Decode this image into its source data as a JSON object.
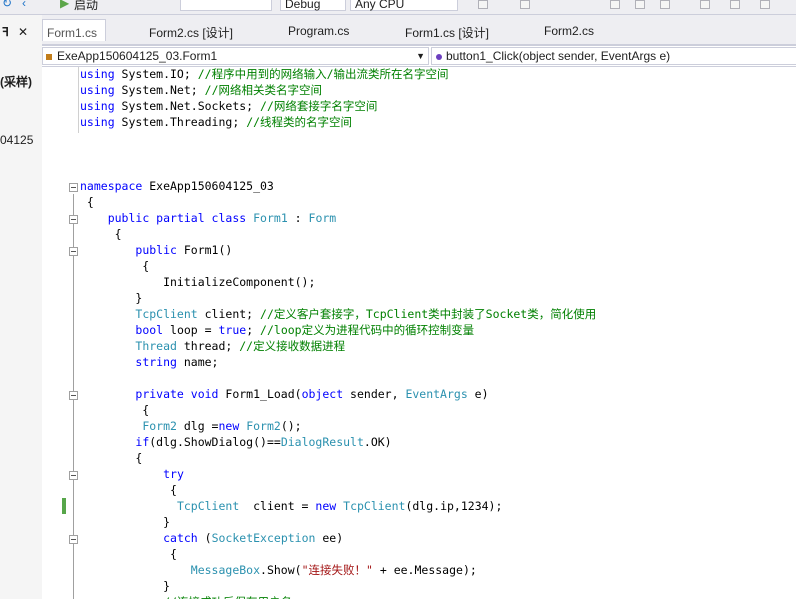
{
  "toolbar": {
    "start_label": "启动",
    "config": "Debug",
    "platform": "Any CPU"
  },
  "left_panel": {
    "pin": "ꟻ",
    "close": "✕",
    "label1": "(采样)",
    "label2": "04125"
  },
  "tabs": [
    {
      "label": "Form1.cs"
    },
    {
      "label": "Form2.cs [设计]"
    },
    {
      "label": "Program.cs"
    },
    {
      "label": "Form1.cs [设计]"
    },
    {
      "label": "Form2.cs"
    }
  ],
  "nav": {
    "class_path": "ExeApp150604125_03.Form1",
    "member": "button1_Click(object sender, EventArgs e)"
  },
  "code": [
    [
      [
        "kw",
        "using"
      ],
      [
        "p",
        " System.IO; "
      ],
      [
        "cm",
        "//程序中用到的网络输入/输出流类所在名字空间"
      ]
    ],
    [
      [
        "kw",
        "using"
      ],
      [
        "p",
        " System.Net; "
      ],
      [
        "cm",
        "//网络相关类名字空间"
      ]
    ],
    [
      [
        "kw",
        "using"
      ],
      [
        "p",
        " System.Net.Sockets; "
      ],
      [
        "cm",
        "//网络套接字名字空间"
      ]
    ],
    [
      [
        "kw",
        "using"
      ],
      [
        "p",
        " System.Threading; "
      ],
      [
        "cm",
        "//线程类的名字空间"
      ]
    ],
    [],
    [],
    [],
    [
      [
        "kw",
        "namespace"
      ],
      [
        "p",
        " ExeApp150604125_03"
      ]
    ],
    [
      [
        "p",
        " {"
      ]
    ],
    [
      [
        "p",
        "    "
      ],
      [
        "kw",
        "public partial class"
      ],
      [
        "p",
        " "
      ],
      [
        "ty",
        "Form1"
      ],
      [
        "p",
        " : "
      ],
      [
        "ty",
        "Form"
      ]
    ],
    [
      [
        "p",
        "     {"
      ]
    ],
    [
      [
        "p",
        "        "
      ],
      [
        "kw",
        "public"
      ],
      [
        "p",
        " Form1()"
      ]
    ],
    [
      [
        "p",
        "         {"
      ]
    ],
    [
      [
        "p",
        "            InitializeComponent();"
      ]
    ],
    [
      [
        "p",
        "        }"
      ]
    ],
    [
      [
        "p",
        "        "
      ],
      [
        "ty",
        "TcpClient"
      ],
      [
        "p",
        " client; "
      ],
      [
        "cm",
        "//定义客户套接字，TcpClient类中封装了Socket类，简化使用"
      ]
    ],
    [
      [
        "p",
        "        "
      ],
      [
        "kw",
        "bool"
      ],
      [
        "p",
        " loop = "
      ],
      [
        "kw",
        "true"
      ],
      [
        "p",
        "; "
      ],
      [
        "cm",
        "//loop定义为进程代码中的循环控制变量"
      ]
    ],
    [
      [
        "p",
        "        "
      ],
      [
        "ty",
        "Thread"
      ],
      [
        "p",
        " thread; "
      ],
      [
        "cm",
        "//定义接收数据进程"
      ]
    ],
    [
      [
        "p",
        "        "
      ],
      [
        "kw",
        "string"
      ],
      [
        "p",
        " name;"
      ]
    ],
    [],
    [
      [
        "p",
        "        "
      ],
      [
        "kw",
        "private void"
      ],
      [
        "p",
        " Form1_Load("
      ],
      [
        "kw",
        "object"
      ],
      [
        "p",
        " sender, "
      ],
      [
        "ty",
        "EventArgs"
      ],
      [
        "p",
        " e)"
      ]
    ],
    [
      [
        "p",
        "         {"
      ]
    ],
    [
      [
        "p",
        "         "
      ],
      [
        "ty",
        "Form2"
      ],
      [
        "p",
        " dlg ="
      ],
      [
        "kw",
        "new"
      ],
      [
        "p",
        " "
      ],
      [
        "ty",
        "Form2"
      ],
      [
        "p",
        "();"
      ]
    ],
    [
      [
        "p",
        "        "
      ],
      [
        "kw",
        "if"
      ],
      [
        "p",
        "(dlg.ShowDialog()=="
      ],
      [
        "ty",
        "DialogResult"
      ],
      [
        "p",
        ".OK)"
      ]
    ],
    [
      [
        "p",
        "        {"
      ]
    ],
    [
      [
        "p",
        "            "
      ],
      [
        "kw",
        "try"
      ]
    ],
    [
      [
        "p",
        "             {"
      ]
    ],
    [
      [
        "p",
        "              "
      ],
      [
        "ty",
        "TcpClient"
      ],
      [
        "p",
        "  client = "
      ],
      [
        "kw",
        "new"
      ],
      [
        "p",
        " "
      ],
      [
        "ty",
        "TcpClient"
      ],
      [
        "p",
        "(dlg.ip,1234);"
      ]
    ],
    [
      [
        "p",
        "            }"
      ]
    ],
    [
      [
        "p",
        "            "
      ],
      [
        "kw",
        "catch"
      ],
      [
        "p",
        " ("
      ],
      [
        "ty",
        "SocketException"
      ],
      [
        "p",
        " ee)"
      ]
    ],
    [
      [
        "p",
        "             {"
      ]
    ],
    [
      [
        "p",
        "                "
      ],
      [
        "ty",
        "MessageBox"
      ],
      [
        "p",
        ".Show("
      ],
      [
        "st",
        "\"连接失败！\""
      ],
      [
        "p",
        " + ee.Message);"
      ]
    ],
    [
      [
        "p",
        "            }"
      ]
    ],
    [
      [
        "p",
        "            "
      ],
      [
        "cm",
        "//连接成功后保存用户名"
      ]
    ]
  ]
}
